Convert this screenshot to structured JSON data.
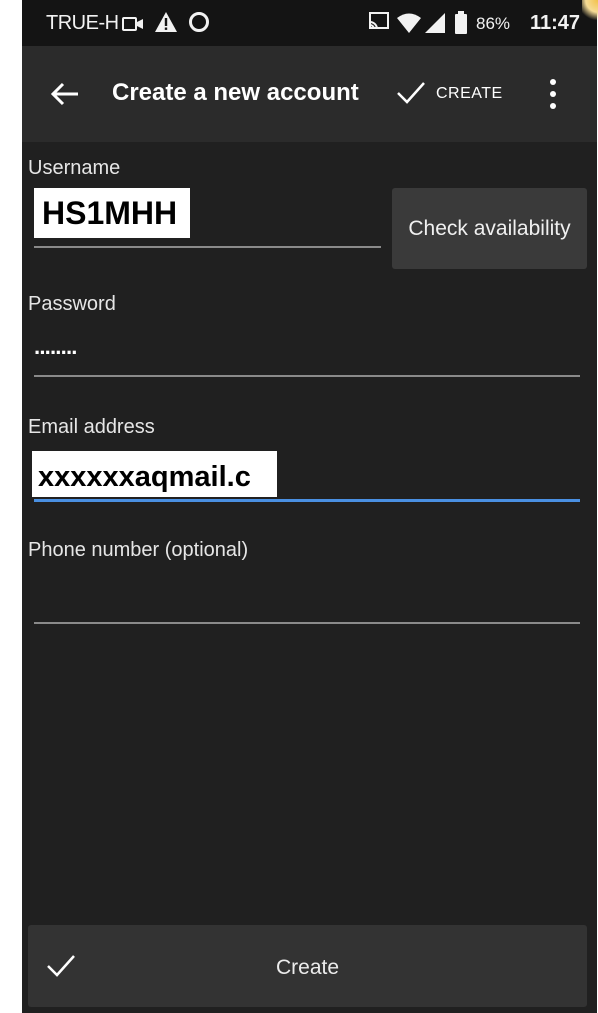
{
  "status_bar": {
    "carrier": "TRUE-H",
    "battery_percent": "86%",
    "time": "11:47",
    "icons": [
      "video-record-icon",
      "warning-icon",
      "circle-icon",
      "cast-icon",
      "wifi-icon",
      "cell-signal-icon",
      "battery-icon"
    ]
  },
  "toolbar": {
    "back_icon": "arrow-left-icon",
    "title": "Create a new account",
    "create_label": "CREATE",
    "overflow_icon": "more-vert-icon"
  },
  "form": {
    "username": {
      "label": "Username",
      "value": "HS1MHH"
    },
    "check_availability_label": "Check availability",
    "password": {
      "label": "Password",
      "value": "········"
    },
    "email": {
      "label": "Email address",
      "value": "xxxxxxaqmail.c"
    },
    "phone": {
      "label": "Phone number (optional)",
      "value": ""
    }
  },
  "bottom_button": {
    "label": "Create",
    "icon": "checkmark-icon"
  },
  "colors": {
    "background": "#202020",
    "toolbar": "#2b2b2b",
    "status_bar": "#141414",
    "accent_underline": "#4a90e2",
    "button_bg": "#3a3a3a"
  }
}
